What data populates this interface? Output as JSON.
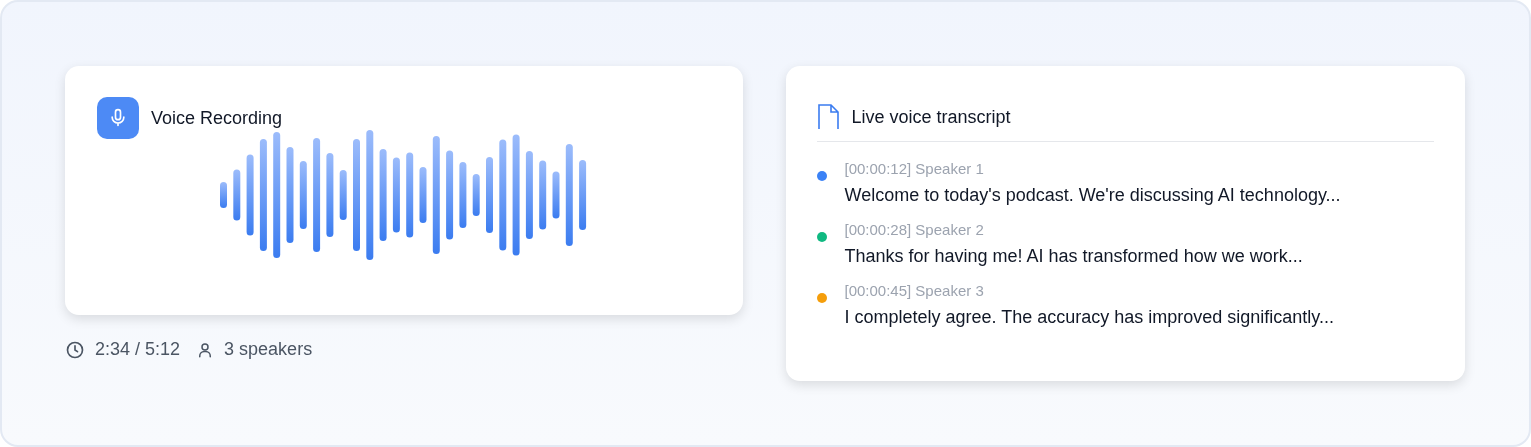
{
  "recording": {
    "title": "Voice Recording",
    "time": "2:34 / 5:12",
    "speakers": "3 speakers"
  },
  "transcript": {
    "title": "Live voice transcript",
    "entries": [
      {
        "meta": "[00:00:12] Speaker 1",
        "text": "Welcome to today's podcast. We're discussing AI technology...",
        "color": "#3b82f6"
      },
      {
        "meta": "[00:00:28] Speaker 2",
        "text": "Thanks for having me! AI has transformed how we work...",
        "color": "#10b981"
      },
      {
        "meta": "[00:00:45] Speaker 3",
        "text": "I completely agree. The accuracy has improved significantly...",
        "color": "#f59e0b"
      }
    ]
  }
}
